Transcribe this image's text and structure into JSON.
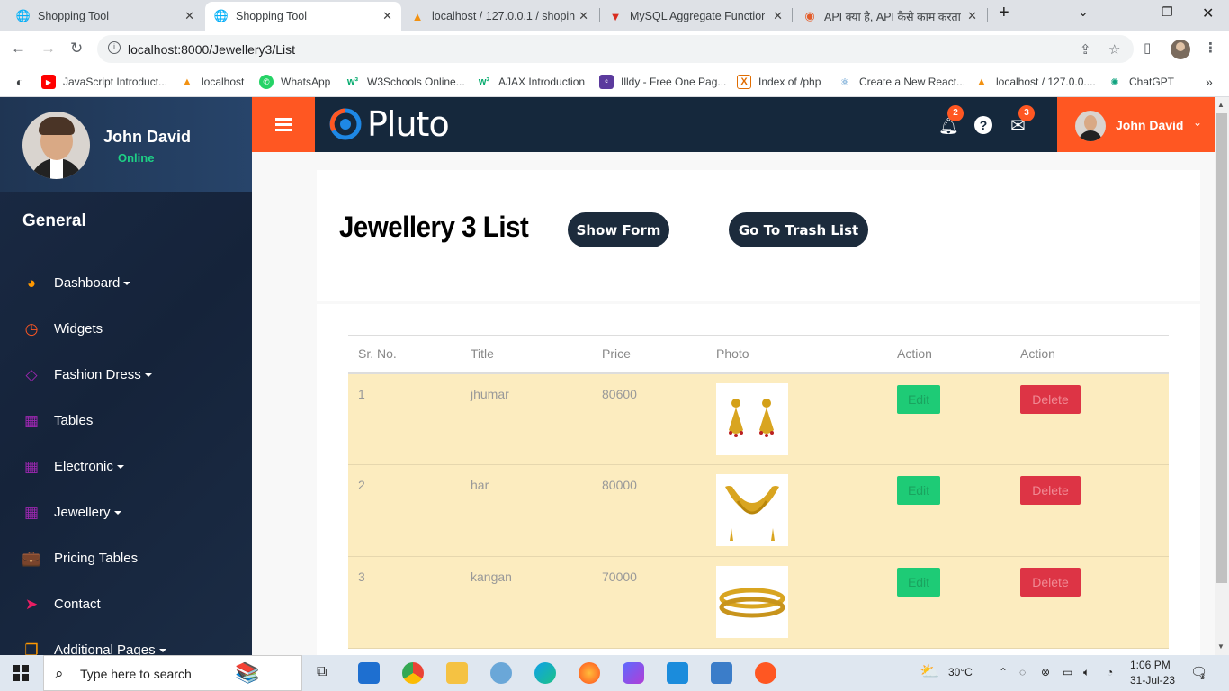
{
  "browser": {
    "tabs": [
      {
        "title": "Shopping Tool",
        "active": false
      },
      {
        "title": "Shopping Tool",
        "active": true
      },
      {
        "title": "localhost / 127.0.0.1 / shopin",
        "active": false
      },
      {
        "title": "MySQL Aggregate Functions",
        "active": false
      },
      {
        "title": "API क्या है, API कैसे काम करता",
        "active": false
      }
    ],
    "url": "localhost:8000/Jewellery3/List",
    "bookmarks": [
      "JavaScript Introduct...",
      "localhost",
      "WhatsApp",
      "W3Schools Online...",
      "AJAX Introduction",
      "Illdy - Free One Pag...",
      "Index of /php",
      "Create a New React...",
      "localhost / 127.0.0....",
      "ChatGPT"
    ]
  },
  "sidebar": {
    "user_name": "John David",
    "user_status": "Online",
    "section_title": "General",
    "items": [
      {
        "label": "Dashboard",
        "icon": "dashboard-icon",
        "color": "#ff9800",
        "dropdown": true
      },
      {
        "label": "Widgets",
        "icon": "clock-icon",
        "color": "#ff5722",
        "dropdown": false
      },
      {
        "label": "Fashion Dress",
        "icon": "diamond-icon",
        "color": "#9c27b0",
        "dropdown": true
      },
      {
        "label": "Tables",
        "icon": "table-icon",
        "color": "#9c27b0",
        "dropdown": false
      },
      {
        "label": "Electronic",
        "icon": "table-icon",
        "color": "#9c27b0",
        "dropdown": true
      },
      {
        "label": "Jewellery",
        "icon": "table-icon",
        "color": "#9c27b0",
        "dropdown": true
      },
      {
        "label": "Pricing Tables",
        "icon": "briefcase-icon",
        "color": "#2196f3",
        "dropdown": false
      },
      {
        "label": "Contact",
        "icon": "paper-plane-icon",
        "color": "#e91e63",
        "dropdown": false
      },
      {
        "label": "Additional Pages",
        "icon": "clone-icon",
        "color": "#ff9800",
        "dropdown": true
      }
    ]
  },
  "topbar": {
    "logo": "Pluto",
    "notifications_count": "2",
    "messages_count": "3",
    "user_name": "John David"
  },
  "page": {
    "title": "Jewellery 3 List",
    "show_form_label": "Show Form",
    "trash_label": "Go To Trash List"
  },
  "table": {
    "headers": [
      "Sr. No.",
      "Title",
      "Price",
      "Photo",
      "Action",
      "Action"
    ],
    "rows": [
      {
        "sr": "1",
        "title": "jhumar",
        "price": "80600",
        "photo": "earrings",
        "edit": "Edit",
        "delete": "Delete"
      },
      {
        "sr": "2",
        "title": "har",
        "price": "80000",
        "photo": "necklace",
        "edit": "Edit",
        "delete": "Delete"
      },
      {
        "sr": "3",
        "title": "kangan",
        "price": "70000",
        "photo": "bangles",
        "edit": "Edit",
        "delete": "Delete"
      }
    ]
  },
  "taskbar": {
    "search_placeholder": "Type here to search",
    "weather": "30°C",
    "time": "1:06 PM",
    "date": "31-Jul-23",
    "notification_count": "3"
  }
}
